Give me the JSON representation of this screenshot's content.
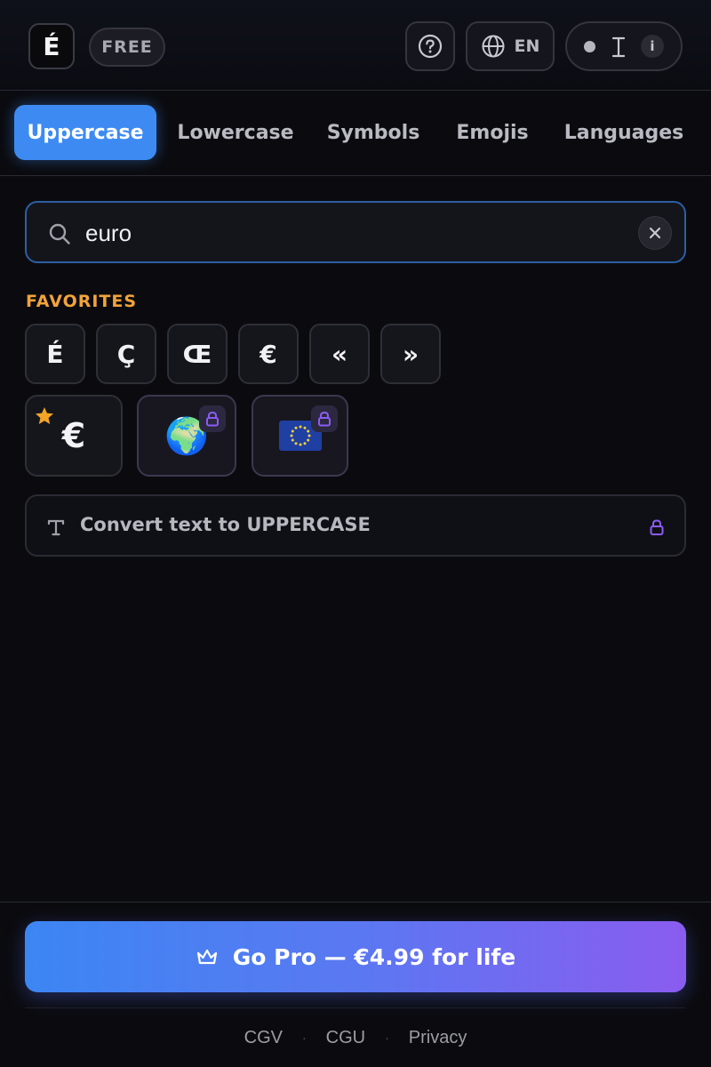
{
  "header": {
    "logo_text": "É",
    "plan_badge": "FREE",
    "help_icon": "help-circle-icon",
    "language": {
      "icon": "globe-icon",
      "code": "EN"
    },
    "mode_toggle": {
      "icons": [
        "dot-icon",
        "text-cursor-icon",
        "info-icon"
      ],
      "info_label": "i"
    }
  },
  "tabs": [
    "Uppercase",
    "Lowercase",
    "Symbols",
    "Emojis",
    "Languages"
  ],
  "active_tab": "Uppercase",
  "search": {
    "value": "euro",
    "icon": "search-icon",
    "clear_icon": "close-icon"
  },
  "favorites": {
    "title": "FAVORITES",
    "keys": [
      "É",
      "Ç",
      "Œ",
      "€",
      "«",
      "»"
    ]
  },
  "results": [
    {
      "glyph": "€",
      "favorited": true,
      "locked": false
    },
    {
      "glyph": "🌍",
      "favorited": false,
      "locked": true
    },
    {
      "glyph": "🇪🇺",
      "favorited": false,
      "locked": true
    }
  ],
  "convert": {
    "label": "Convert text to UPPERCASE",
    "icon": "text-icon",
    "locked": true
  },
  "go_pro": {
    "label": "Go Pro — €4.99 for life",
    "icon": "crown-icon"
  },
  "footer_links": [
    "CGV",
    "CGU",
    "Privacy"
  ],
  "colors": {
    "accent": "#3d8bf2",
    "favorites_title": "#f2a33a",
    "lock": "#8b5cf6",
    "pro_gradient_start": "#3c86f3",
    "pro_gradient_end": "#8a5cf0"
  }
}
